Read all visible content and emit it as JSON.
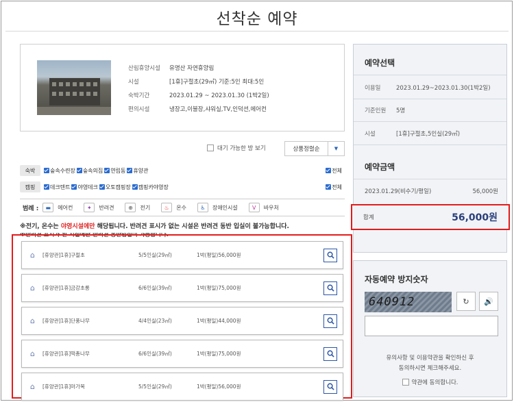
{
  "page_title": "선착순 예약",
  "facility": {
    "rows": [
      {
        "label": "산림휴양시설",
        "value": "유명산 자연휴양림"
      },
      {
        "label": "시설",
        "value": "[1휴]구절초(29㎡) 기준:5인 최대:5인"
      },
      {
        "label": "숙박기간",
        "value": "2023.01.29 ~ 2023.01.30 (1박2일)"
      },
      {
        "label": "편의시설",
        "value": "냉장고,이불장,샤워실,TV,인덕션,에어컨"
      }
    ]
  },
  "filters": {
    "waitable_label": "대기 가능한 방 보기",
    "sort_label": "상품정렬순",
    "categories": [
      {
        "tag": "숙박",
        "items": [
          "숲속수련장",
          "숲속의집",
          "연립동",
          "휴양관"
        ],
        "all": "전체"
      },
      {
        "tag": "캠핑",
        "items": [
          "데크텐트",
          "야영데크",
          "오토캠핑장",
          "캠핑카야영장"
        ],
        "all": "전체"
      }
    ]
  },
  "legend": {
    "title": "범례 :",
    "items": [
      {
        "label": "에어컨",
        "icon": "air-conditioner-icon",
        "color": "#2b66b5"
      },
      {
        "label": "반려견",
        "icon": "pet-icon",
        "color": "#8e44ad"
      },
      {
        "label": "전기",
        "icon": "electric-icon",
        "color": "#555555"
      },
      {
        "label": "온수",
        "icon": "hot-water-icon",
        "color": "#e02020"
      },
      {
        "label": "장애인시설",
        "icon": "accessible-icon",
        "color": "#2b66b5"
      },
      {
        "label": "바우처",
        "icon": "voucher-icon",
        "color": "#c0399a"
      }
    ]
  },
  "notices": {
    "line1_a": "※전기, 온수는 ",
    "line1_red": "야영시설에만",
    "line1_b": " 해당됩니다. 반려견 표시가 없는 시설은 반려견 동반 입실이 불가능합니다.",
    "line2": "※반려견 표시가 된 시설에만 반려견 동반입실이 가능합니다."
  },
  "rooms": [
    {
      "name": "[휴양관]1휴]구절초",
      "people": "5/5인실(29㎡)",
      "price": "1박(평일)56,000원"
    },
    {
      "name": "[휴양관]1휴]금강초롱",
      "people": "6/6인실(39㎡)",
      "price": "1박(평일)75,000원"
    },
    {
      "name": "[휴양관]1휴]단풍나무",
      "people": "4/4인실(23㎡)",
      "price": "1박(평일)44,000원"
    },
    {
      "name": "[휴양관]1휴]떡총나무",
      "people": "6/6인실(39㎡)",
      "price": "1박(평일)75,000원"
    },
    {
      "name": "[휴양관]1휴]마가목",
      "people": "5/5인실(29㎡)",
      "price": "1박(평일)56,000원"
    }
  ],
  "reservation": {
    "heading": "예약선택",
    "period_label": "이용일",
    "period_value": "2023.01.29~2023.01.30(1박2일)",
    "people_label": "기준인원",
    "people_value": "5명",
    "facility_label": "시설",
    "facility_value": "[1휴]구절초,5인실(29㎡)"
  },
  "amount": {
    "heading": "예약금액",
    "line_label": "2023.01.29(비수기/평일)",
    "line_value": "56,000원",
    "total_label": "합계",
    "total_value": "56,000원"
  },
  "captcha": {
    "heading": "자동예약 방지숫자",
    "code": "640912",
    "input_value": "",
    "note_line1": "유의사항 및 이용약관을 확인하신 후",
    "note_line2": "동의하시면 체크해주세요.",
    "agree_label": "약관에 동의합니다."
  },
  "colors": {
    "accent": "#2a3f7a",
    "highlight": "#e21b1b",
    "checkbox": "#2a6bd1"
  }
}
